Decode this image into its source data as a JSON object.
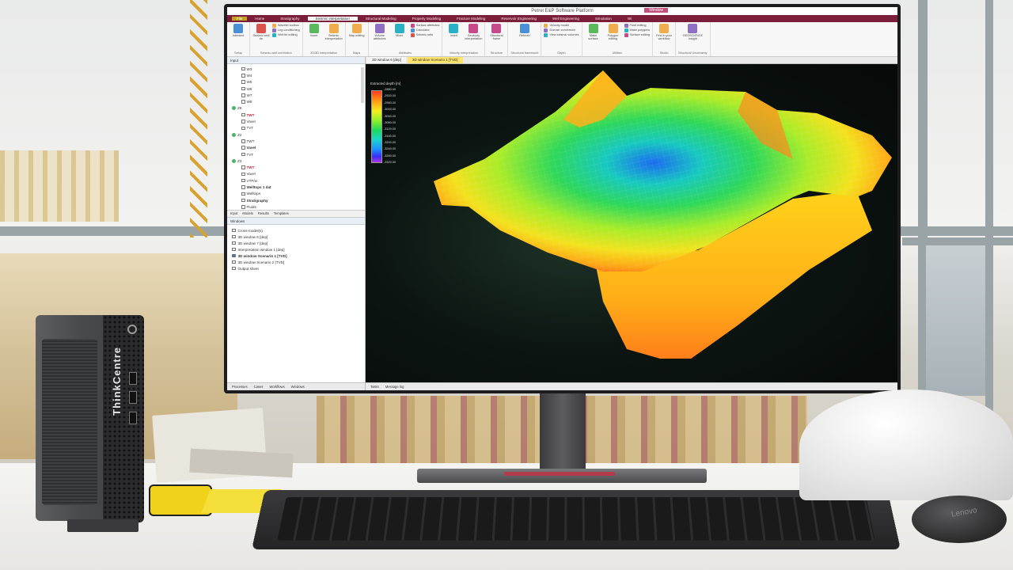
{
  "app": {
    "title": "Petrel E&P Software Platform",
    "context_tab": "Window"
  },
  "ribbon_tabs": [
    "File",
    "Home",
    "Stratigraphy",
    "Seismic interpretation",
    "Structural Modeling",
    "Property Modeling",
    "Fracture Modeling",
    "Reservoir Engineering",
    "Well Engineering",
    "Simulation",
    "Wi"
  ],
  "ribbon": {
    "groups": [
      {
        "name": "Setup",
        "buttons": [
          "Intersect"
        ],
        "small": []
      },
      {
        "name": "Seismic-well correlation",
        "buttons": [
          "Seismic well tie"
        ],
        "small": [
          "Wavelet toolbox",
          "Log conditioning",
          "Well tie editing"
        ]
      },
      {
        "name": "2D/3D interpretation",
        "buttons": [
          "Insert",
          "Seismic interpretation"
        ],
        "small": []
      },
      {
        "name": "Maps",
        "buttons": [
          "Map editing"
        ],
        "small": []
      },
      {
        "name": "Attributes",
        "buttons": [
          "Volume attributes",
          "Mixer"
        ],
        "small": [
          "Surface attributes",
          "Calculator",
          "Seismic sets"
        ]
      },
      {
        "name": "Velocity interpretation",
        "buttons": [
          "Insert",
          "Geobody interpretation"
        ],
        "small": []
      },
      {
        "name": "Structure",
        "buttons": [
          "Structural frame"
        ],
        "small": []
      },
      {
        "name": "Structural framework",
        "buttons": [
          "Refresh"
        ],
        "small": []
      },
      {
        "name": "Depth",
        "buttons": [],
        "small": [
          "Velocity model",
          "Domain conversion",
          "View seismic volumes"
        ]
      },
      {
        "name": "Utilities",
        "buttons": [
          "Make surface",
          "Polygon editing"
        ],
        "small": [
          "Point editing",
          "Make polygons",
          "Surface editing"
        ]
      },
      {
        "name": "Studio",
        "buttons": [
          "Find in your workflow"
        ],
        "small": []
      },
      {
        "name": "Structural Uncertainty",
        "buttons": [
          "GEOSCIENCE Insight"
        ],
        "small": []
      }
    ]
  },
  "input_pane": {
    "header": "Input",
    "tree": [
      {
        "label": "W3",
        "kind": "check"
      },
      {
        "label": "W4",
        "kind": "check"
      },
      {
        "label": "W5",
        "kind": "check"
      },
      {
        "label": "W6",
        "kind": "check"
      },
      {
        "label": "W7",
        "kind": "check"
      },
      {
        "label": "W8",
        "kind": "check"
      },
      {
        "label": "Z6",
        "kind": "group"
      },
      {
        "label": "TWT",
        "kind": "red"
      },
      {
        "label": "Vavel",
        "kind": "check"
      },
      {
        "label": "TVT",
        "kind": "check"
      },
      {
        "label": "Z2",
        "kind": "group"
      },
      {
        "label": "TWT",
        "kind": "check"
      },
      {
        "label": "Vavel",
        "kind": "bold"
      },
      {
        "label": "TVT",
        "kind": "check"
      },
      {
        "label": "Z3",
        "kind": "group"
      },
      {
        "label": "TWT",
        "kind": "red"
      },
      {
        "label": "Vavel",
        "kind": "check"
      },
      {
        "label": "VTP/w",
        "kind": "check"
      },
      {
        "label": "Welltops 1 dat",
        "kind": "bold"
      },
      {
        "label": "Welltops",
        "kind": "check"
      },
      {
        "label": "Stratigraphy",
        "kind": "bold"
      },
      {
        "label": "Fluids",
        "kind": "check"
      }
    ],
    "tabs": [
      "Input",
      "Models",
      "Results",
      "Templates"
    ]
  },
  "windows_pane": {
    "header": "Windows",
    "items": [
      {
        "label": "Cross-model(s)",
        "bold": false
      },
      {
        "label": "3D window 6 [dep]",
        "bold": false
      },
      {
        "label": "3D window 7 [dep]",
        "bold": false
      },
      {
        "label": "Interpretation window 1 [dep]",
        "bold": false
      },
      {
        "label": "3D window Scenario 1 [TVD]",
        "bold": true
      },
      {
        "label": "3D window Scenario 2 [TVD]",
        "bold": false
      },
      {
        "label": "Output sheet",
        "bold": false
      }
    ],
    "bottom_tabs": [
      "Processes",
      "Cases",
      "Workflows",
      "Windows"
    ]
  },
  "viewer": {
    "tabs": [
      {
        "label": "3D window 6 [dep]",
        "active": false
      },
      {
        "label": "3D window Scenario 1 [TVD]",
        "active": true
      }
    ],
    "status_tabs": [
      "Tasks",
      "Message log"
    ],
    "legend_title": "Extracted depth [m]",
    "legend_ticks": [
      "-2880.00",
      "-2920.00",
      "-2960.00",
      "-3000.00",
      "-3040.00",
      "-3080.00",
      "-3120.00",
      "-3160.00",
      "-3200.00",
      "-3240.00",
      "-3280.00",
      "-3320.00"
    ],
    "colors": {
      "viewport_bg": "#0c1512",
      "accent": "#7b1e3a"
    }
  },
  "hardware": {
    "pc_brand": "ThinkCentre",
    "mouse_brand": "Lenovo"
  }
}
